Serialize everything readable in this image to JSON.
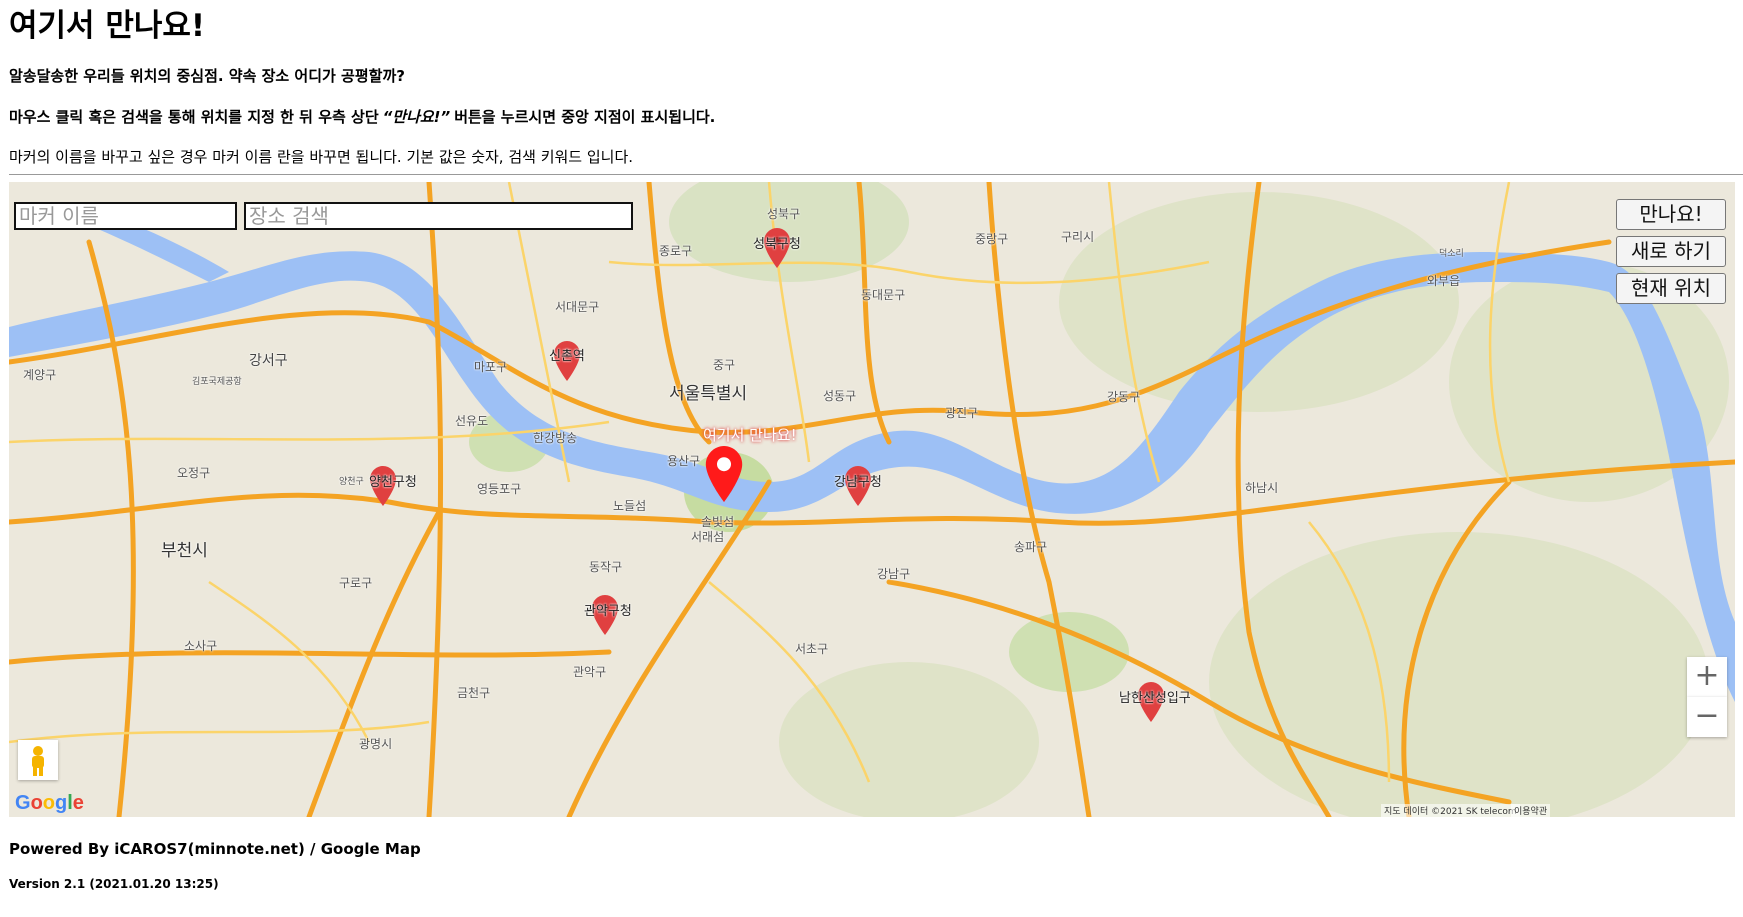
{
  "header": {
    "title": "여기서 만나요!",
    "subtitle": "알송달송한 우리들 위치의 중심점. 약속 장소 어디가 공평할까?",
    "instruction_prefix": "마우스 클릭 혹은 검색을 통해 위치를 지정 한 뒤 우측 상단",
    "instruction_quoted": "“만나요!”",
    "instruction_suffix": "버튼을 누르시면 중앙 지점이 표시됩니다.",
    "note": "마커의 이름을 바꾸고 싶은 경우 마커 이름 란을 바꾸면 됩니다. 기본 값은 숫자, 검색 키워드 입니다."
  },
  "map": {
    "marker_name_placeholder": "마커 이름",
    "place_search_placeholder": "장소 검색",
    "buttons": {
      "meet": "만나요!",
      "reset": "새로 하기",
      "current_location": "현재 위치"
    },
    "center_marker_label": "여기서 만나요!",
    "markers": [
      {
        "label": "성북구청"
      },
      {
        "label": "신촌역"
      },
      {
        "label": "양천구청"
      },
      {
        "label": "강남구청"
      },
      {
        "label": "관악구청"
      },
      {
        "label": "남한산성입구"
      }
    ],
    "place_labels": {
      "seoul": "서울특별시",
      "gangseo": "강서구",
      "gimpo_airport": "김포국제공항",
      "mapo": "마포구",
      "seodaemun": "서대문구",
      "jongno": "종로구",
      "jung": "중구",
      "seongbuk": "성북구",
      "dongdaemun": "동대문구",
      "jungnang": "중랑구",
      "guri": "구리시",
      "seongdong": "성동구",
      "gwangjin": "광진구",
      "gangdong": "강동구",
      "hanam": "하남시",
      "yongsan": "용산구",
      "seonyudo": "선유도",
      "hangang_park": "한강방송",
      "yeongdeungpo": "영등포구",
      "nodeulseom": "노들섬",
      "seorae": "서래섬",
      "solbit": "솔빛섬",
      "dongjak": "동작구",
      "guro": "구로구",
      "gwanak": "관악구",
      "seocho": "서초구",
      "gangnam": "강남구",
      "songpa": "송파구",
      "bucheon": "부천시",
      "sosa": "소사구",
      "geumcheon": "금천구",
      "gwangmyeong": "광명시",
      "ojeong": "오정구",
      "gyeyang": "계양구",
      "yangcheon": "양천구",
      "wabu": "와부읍",
      "deokso": "덕소리"
    },
    "zoom_in": "+",
    "zoom_out": "−",
    "google_logo": "Google",
    "attribution": "지도 데이터 ©2021 SK telecom",
    "terms": "이용약관",
    "colors": {
      "water": "#9dc0f5",
      "road_major": "#f4a323",
      "road_minor": "#fbd46a",
      "park": "#c6dca1",
      "marker": "#e04040",
      "center_marker": "#ff1a1a"
    }
  },
  "footer": {
    "powered_by": "Powered By iCAROS7(minnote.net) / Google Map",
    "version": "Version 2.1 (2021.01.20 13:25)"
  }
}
